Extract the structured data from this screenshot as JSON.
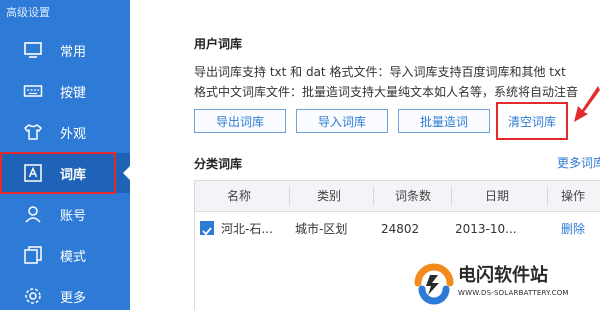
{
  "sidebar": {
    "title": "高级设置",
    "items": [
      {
        "label": "常用",
        "icon": "monitor-icon"
      },
      {
        "label": "按键",
        "icon": "keyboard-icon"
      },
      {
        "label": "外观",
        "icon": "shirt-icon"
      },
      {
        "label": "词库",
        "icon": "dictionary-icon"
      },
      {
        "label": "账号",
        "icon": "person-icon"
      },
      {
        "label": "模式",
        "icon": "mode-icon"
      },
      {
        "label": "更多",
        "icon": "gear-icon"
      }
    ],
    "active_index": 3
  },
  "user_lexicon": {
    "title": "用户词库",
    "desc_line1": "导出词库支持 txt 和 dat 格式文件：导入词库支持百度词库和其他 txt",
    "desc_line2": "格式中文词库文件：批量造词支持大量纯文本如人名等，系统将自动注音",
    "buttons": {
      "export": "导出词库",
      "import": "导入词库",
      "batch": "批量造词",
      "clear": "清空词库"
    }
  },
  "category_lexicon": {
    "title": "分类词库",
    "more_link": "更多词库",
    "columns": [
      "名称",
      "类别",
      "词条数",
      "日期",
      "操作"
    ],
    "rows": [
      {
        "checked": true,
        "name": "河北-石...",
        "category": "城市-区划",
        "count": "24802",
        "date": "2013-10...",
        "action": "删除"
      }
    ]
  },
  "watermark": {
    "name": "电闪软件站",
    "url": "WWW.DS-SOLARBATTERY.COM"
  },
  "colors": {
    "sidebar_bg": "#2d7bd6",
    "accent": "#2d7bd6",
    "highlight_red": "#e32b2b"
  }
}
